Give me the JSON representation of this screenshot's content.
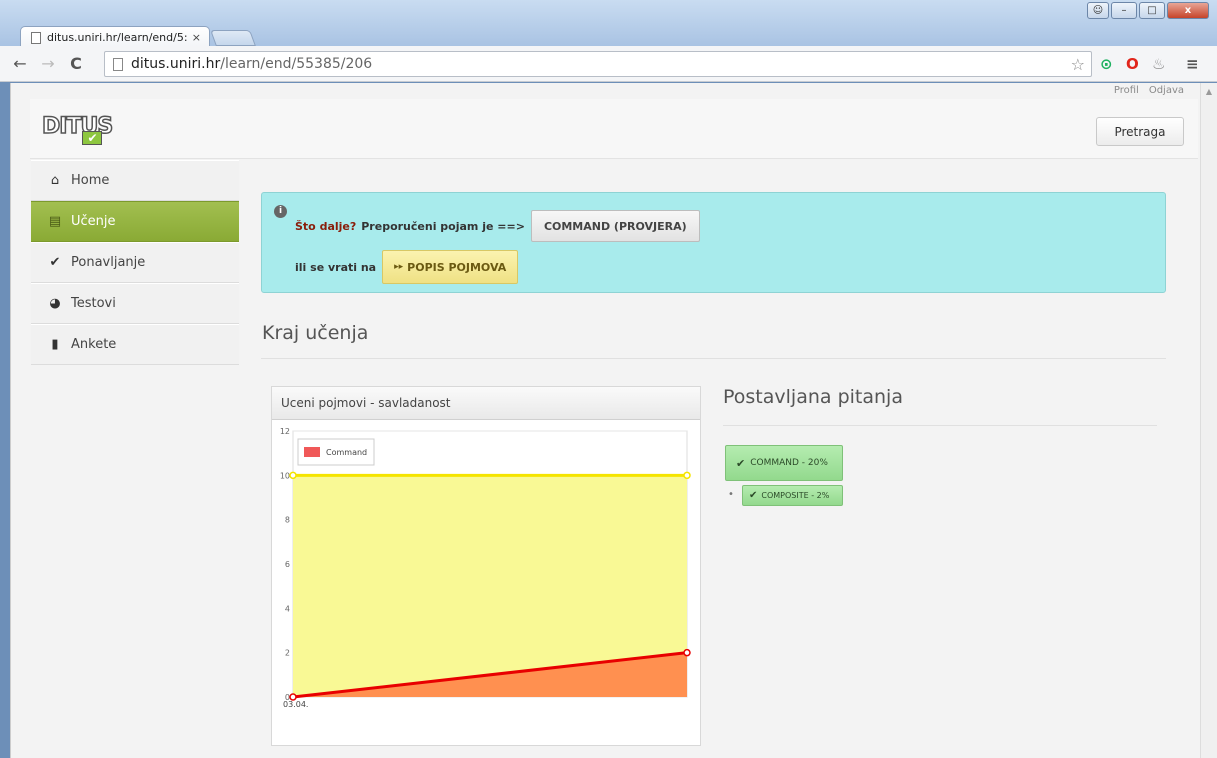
{
  "browser": {
    "tab_title": "ditus.uniri.hr/learn/end/5:",
    "tab_close": "×",
    "url_host": "ditus.uniri.hr",
    "url_path": "/learn/end/55385/206",
    "back_icon": "←",
    "forward_icon": "→",
    "reload_icon": "C",
    "star_icon": "☆",
    "menu_icon": "≡",
    "minimize_icon": "–",
    "maximize_icon": "□",
    "close_icon": "x"
  },
  "header": {
    "top_links": [
      "Profil",
      "Odjava"
    ],
    "logo_text": "DITUS",
    "search_button": "Pretraga"
  },
  "sidebar": {
    "items": [
      {
        "label": "Home",
        "icon": "⌂",
        "active": false
      },
      {
        "label": "Učenje",
        "icon": "▤",
        "active": true
      },
      {
        "label": "Ponavljanje",
        "icon": "✔",
        "active": false
      },
      {
        "label": "Testovi",
        "icon": "◕",
        "active": false
      },
      {
        "label": "Ankete",
        "icon": "▮",
        "active": false
      }
    ]
  },
  "alert": {
    "info_icon": "i",
    "question": "Što dalje?",
    "recommend_text": "Preporučeni pojam je ==>",
    "command_button": "COMMAND (PROVJERA)",
    "back_text": "ili se vrati na",
    "popis_icon": "▸▸",
    "popis_button": "POPIS POJMOVA"
  },
  "main": {
    "title": "Kraj učenja",
    "chart_panel_title": "Uceni pojmovi - savladanost",
    "questions_title": "Postavljana pitanja",
    "check_icon": "✔",
    "badges": [
      {
        "label": "COMMAND - 20%"
      },
      {
        "label": "COMPOSITE - 2%"
      }
    ],
    "bullet": "•"
  },
  "colors": {
    "accent_green": "#9ab945",
    "alert_bg": "#a8ebec",
    "chart_area_yellow": "#f9f995",
    "chart_line_yellow": "#f5e400",
    "chart_area_orange": "#ff9050",
    "chart_line_red": "#e80000",
    "legend_swatch": "#f05858"
  },
  "chart_data": {
    "type": "area",
    "x": [
      "03.04.",
      ""
    ],
    "yticks": [
      "0",
      "2",
      "4",
      "6",
      "8",
      "10",
      "12"
    ],
    "ylim": [
      0,
      12
    ],
    "legend": [
      "Command"
    ],
    "legend_position": "top-left",
    "grid": true,
    "series": [
      {
        "name": "Command",
        "values": [
          0,
          2
        ],
        "color": "#e80000",
        "fill": "#ff9050"
      },
      {
        "values": [
          10,
          10
        ],
        "color": "#f5e400",
        "fill": "#f9f995"
      }
    ]
  }
}
